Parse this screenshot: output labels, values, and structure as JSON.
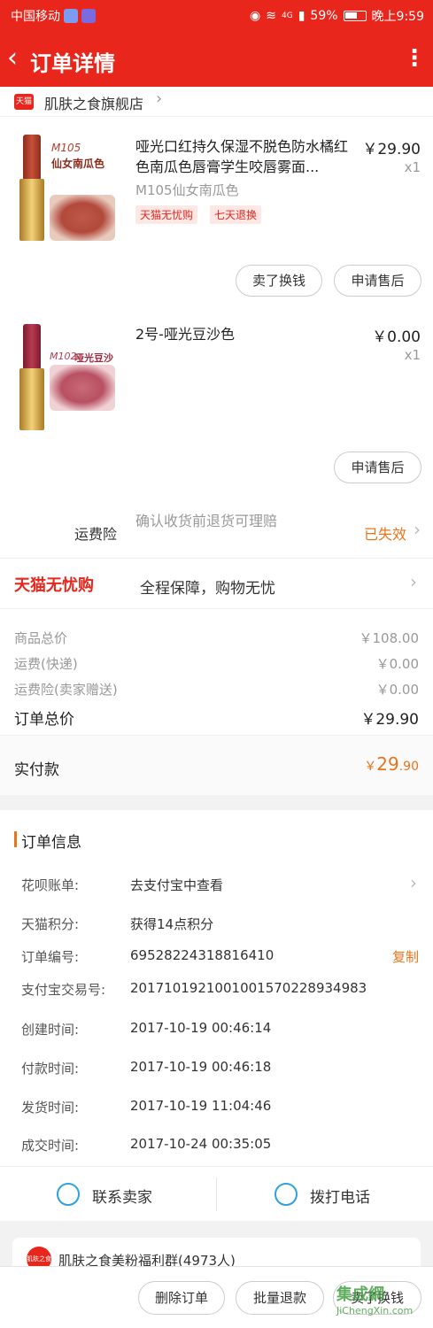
{
  "status_bar": {
    "carrier": "中国移动",
    "network": "4G",
    "battery": "59%",
    "time": "晚上9:59"
  },
  "header": {
    "back": "‹",
    "title": "订单详情",
    "more": "⋮"
  },
  "shop": {
    "badge": "天猫",
    "name": "肌肤之食旗舰店",
    "chevron": "›"
  },
  "products": [
    {
      "title": "哑光口红持久保湿不脱色防水橘红色南瓜色唇膏学生咬唇雾面...",
      "sku": "M105仙女南瓜色",
      "price": "￥29.90",
      "qty": "x1",
      "tags": [
        "天猫无忧购",
        "七天退换"
      ],
      "thumb_code": "M105",
      "thumb_name": "仙女南瓜色",
      "actions": [
        "卖了换钱",
        "申请售后"
      ]
    },
    {
      "title": "2号-哑光豆沙色",
      "sku": "",
      "price": "￥0.00",
      "qty": "x1",
      "thumb_code": "M102",
      "thumb_name": "哑光豆沙色",
      "actions": [
        "申请售后"
      ]
    }
  ],
  "insurance": {
    "label": "运费险",
    "desc": "确认收货前退货可理赔",
    "status": "已失效",
    "chevron": "›"
  },
  "guarantee": {
    "logo": "天猫无忧购",
    "text": "全程保障，购物无忧",
    "chevron": "›"
  },
  "prices": {
    "goods_total_label": "商品总价",
    "goods_total": "￥108.00",
    "shipping_label": "运费(快递)",
    "shipping": "￥0.00",
    "insurance_label": "运费险(卖家赠送)",
    "insurance": "￥0.00",
    "order_total_label": "订单总价",
    "order_total": "￥29.90",
    "paid_label": "实付款",
    "paid_symbol": "￥",
    "paid_int": "29",
    "paid_dec": ".90"
  },
  "order_info": {
    "title": "订单信息",
    "rows": [
      {
        "k": "花呗账单:",
        "v": "去支付宝中查看"
      },
      {
        "k": "天猫积分:",
        "v": "获得14点积分"
      },
      {
        "k": "订单编号:",
        "v": "69528224318816410"
      },
      {
        "k": "支付宝交易号:",
        "v": "2017101921001001570228934983"
      },
      {
        "k": "创建时间:",
        "v": "2017-10-19 00:46:14"
      },
      {
        "k": "付款时间:",
        "v": "2017-10-19 00:46:18"
      },
      {
        "k": "发货时间:",
        "v": "2017-10-19 11:04:46"
      },
      {
        "k": "成交时间:",
        "v": "2017-10-24 00:35:05"
      }
    ],
    "copy": "复制",
    "chevron": "›"
  },
  "contact": {
    "seller": "联系卖家",
    "call": "拨打电话"
  },
  "group": {
    "avatar": "肌肤之食",
    "name": "肌肤之食美粉福利群(4973人)"
  },
  "bottom_actions": [
    "删除订单",
    "批量退款",
    "卖了换钱"
  ],
  "watermark": {
    "main": "集成網",
    "sub": "JiChengXin.com"
  },
  "colors": {
    "brand_red": "#e8261c",
    "accent_orange": "#e8741c",
    "link_blue": "#2fa0e0"
  }
}
